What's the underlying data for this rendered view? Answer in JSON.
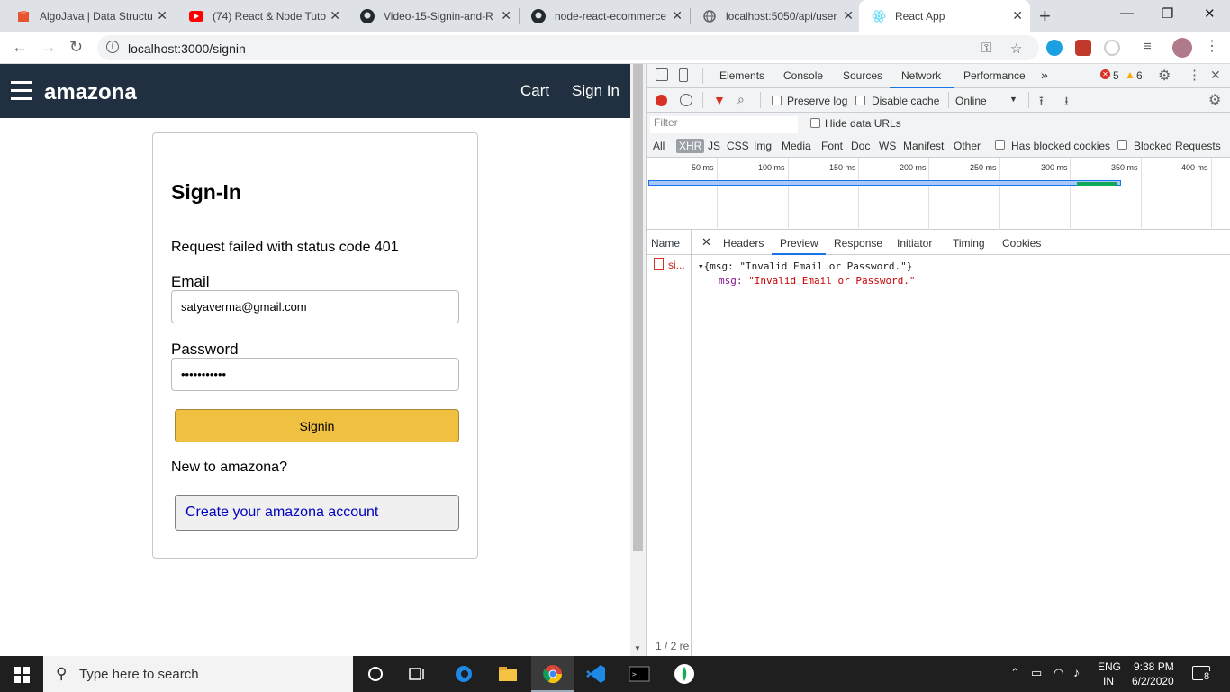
{
  "browser": {
    "tabs": [
      {
        "title": "AlgoJava | Data Structu",
        "icon": "algojava-icon"
      },
      {
        "title": "(74) React & Node Tuto",
        "icon": "youtube-icon"
      },
      {
        "title": "Video-15-Signin-and-R",
        "icon": "github-icon"
      },
      {
        "title": "node-react-ecommerce",
        "icon": "github-icon"
      },
      {
        "title": "localhost:5050/api/user",
        "icon": "globe-icon"
      },
      {
        "title": "React App",
        "icon": "react-icon"
      }
    ],
    "url": "localhost:3000/signin"
  },
  "app": {
    "brand": "amazona",
    "nav": {
      "cart": "Cart",
      "signin": "Sign In"
    },
    "form": {
      "title": "Sign-In",
      "error": "Request failed with status code 401",
      "email_label": "Email",
      "email_value": "satyaverma@gmail.com",
      "password_label": "Password",
      "password_value": "•••••••••••",
      "submit": "Signin",
      "new_to": "New to amazona?",
      "create_account": "Create your amazona account"
    }
  },
  "devtools": {
    "tabs": [
      "Elements",
      "Console",
      "Sources",
      "Network",
      "Performance",
      "»"
    ],
    "errors": "5",
    "warnings": "6",
    "toolbar": {
      "preserve_log": "Preserve log",
      "disable_cache": "Disable cache",
      "throttle": "Online"
    },
    "filter_placeholder": "Filter",
    "hide_data_urls": "Hide data URLs",
    "resource_types": [
      "All",
      "XHR",
      "JS",
      "CSS",
      "Img",
      "Media",
      "Font",
      "Doc",
      "WS",
      "Manifest",
      "Other"
    ],
    "has_blocked_cookies": "Has blocked cookies",
    "blocked_requests": "Blocked Requests",
    "timeline_labels": [
      "50 ms",
      "100 ms",
      "150 ms",
      "200 ms",
      "250 ms",
      "300 ms",
      "350 ms",
      "400 ms"
    ],
    "name_header": "Name",
    "request_name": "si...",
    "footer": "1 / 2 re",
    "detail_tabs": [
      "Headers",
      "Preview",
      "Response",
      "Initiator",
      "Timing",
      "Cookies"
    ],
    "preview": {
      "summary": "{msg: \"Invalid Email or Password.\"}",
      "key": "msg:",
      "value": "\"Invalid Email or Password.\""
    }
  },
  "taskbar": {
    "search_placeholder": "Type here to search",
    "lang": "ENG",
    "region": "IN",
    "time": "9:38 PM",
    "date": "6/2/2020",
    "notifications": "8"
  }
}
